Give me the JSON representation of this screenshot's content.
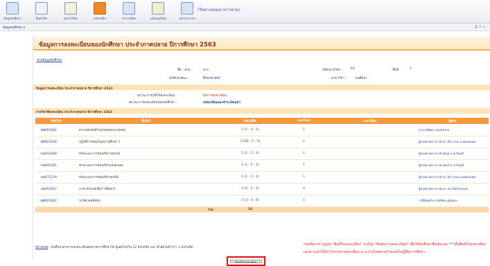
{
  "toolbar": {
    "items": [
      {
        "label": "ข้อมูลนักศึกษา"
      },
      {
        "label": "ยื่นคำร้อง"
      },
      {
        "label": "ผลการเรียน"
      },
      {
        "label": "ลงทะเบียน"
      },
      {
        "label": "ตารางเรียน"
      },
      {
        "label": "แจ้งแผนเรียน"
      },
      {
        "label": "ออกจากระบบ"
      }
    ],
    "title": "(วิทยาเขตมหาสารคาม)"
  },
  "subbar": {
    "left": "ข้อมูลนักศึกษา ▾",
    "right": "⎙ ↕ ▭"
  },
  "page": {
    "title": "ข้อมูลการลงทะเบียนของนักศึกษา ประจำภาคปลาย ปีการศึกษา 2563"
  },
  "student": {
    "link": "ส่วนข้อมูลนักศึกษา",
    "name_label": "ชื่อ - สกุล :",
    "name_value": "นาง",
    "status_label": "สถานะ :",
    "status_value": "นักศึกษาปกติ",
    "id_label": "รหัสประจำตัว :",
    "id_value": "63",
    "level_label": "ชั้นปี :",
    "level_value": "1",
    "program_label": "นักศึกษาคณะ :",
    "program_value": "ศึกษาศาสตร์",
    "major_label": "สาขาวิชา :",
    "major_value": "พลศึกษา"
  },
  "registration": {
    "header": "ข้อมูลการลงทะเบียน ประจำภาคปลาย ปีการศึกษา 2563",
    "status_label": "สถานะการเปิดให้ลงทะเบียน :",
    "status_value": "ปิดการลงทะเบียน",
    "reg_label": "สถานะการลงทะเบียนของนักศึกษา :",
    "reg_value": "ลงทะเบียนและชำระเงินแล้ว"
  },
  "courses": {
    "header": "รายวิชาที่ลงทะเบียน ประจำภาคปลาย ปีการศึกษา 2563",
    "columns": [
      "รหัสวิชา",
      "ชื่อวิชา",
      "หน่วยกิต",
      "section",
      "เวลาเรียน",
      "ผู้สอน"
    ],
    "rows": [
      {
        "code": "ศศ001004",
        "name": "ความสัมพันธ์กับปกครองและชุมชน",
        "credit": "2 (1 - 2 - 3)",
        "section": "1",
        "time": "",
        "teacher": "อาจารย์นิตยา ทองกันสาย"
      },
      {
        "code": "ศศ021034",
        "name": "ปฏิบัติการสอนในสถานศึกษา 1",
        "credit": "2 (90 - 0 - 0)",
        "section": "1",
        "time": "",
        "teacher": "ผู้ช่วยศาสตราจารย์ ดร. จีระวรรณ กมลพนธนพร"
      },
      {
        "code": "พล032448",
        "name": "ทักษะและการสอนกีฬาวอลเลย์",
        "credit": "2 (1 - 2 - 3)",
        "section": "1",
        "time": "",
        "teacher": "ผู้ช่วยศาสตราจารย์ สุพจน์ นาจาริยนต์"
      },
      {
        "code": "พล042181",
        "name": "ทักษะและการสอนกีฬาแฮนด์บอล",
        "credit": "2 (1 - 2 - 3)",
        "section": "1",
        "time": "",
        "teacher": "ผู้ช่วยศาสตราจารย์ สุพจน์ นาจาริยนต์"
      },
      {
        "code": "พล072139",
        "name": "ทักษะและการสอนกีฬาเทนนิส",
        "credit": "2 (1 - 2 - 3)",
        "section": "1",
        "time": "",
        "teacher": "ผู้ช่วยศาสตราจารย์ ดร. จีระวรรณ กมลพนธนพร"
      },
      {
        "code": "มส051057",
        "name": "ภาษาอังกฤษเพื่อการสื่อสาร",
        "credit": "3 (2 - 2 - 5)",
        "section": "4",
        "time": "",
        "teacher": "ผู้ช่วยศาสตราจารย์ ดร. ประวิทย์ ทรงกนธ"
      },
      {
        "code": "ศศ021002",
        "name": "นวนิยายคดีสมัย",
        "credit": "3 (3 - 0 - 6)",
        "section": "1",
        "time": "",
        "teacher": "ว่าที่ร้อยตรี ดร.กิตติชัย แย้มอ่อน"
      }
    ],
    "total_label": "รวม",
    "total_value": "16"
  },
  "note": {
    "link": "หมายเหตุ",
    "text": ": นักศึกษาสามารถลงทะเบียนต่อภาคการศึกษาได้ สูงสุดไม่เกิน 22 หน่วยกิต และ ต่ำสุดไม่ต่ำกว่า 2 หน่วยกิต"
  },
  "warning": {
    "text": "ก่อนที่จะปรากฏปุ่ม \"พิมพ์ใบลงทะเบียน\" จะมีปุ่ม \"ยืนยันการลงทะเบียน\" เพื่อให้นักศึกษายืนยันก่อน ***เมื่อพิมพ์ใบลงทะเบียนเอกสารแล้วให้นำไปจ่ายค่าลงทะเบียน ณ ธ.กรุงไทยตามกำหนดในปฏิทินการศึกษา"
  },
  "print_button": {
    "label": "พิมพ์ใบลงทะเบียน"
  },
  "colors": {
    "accent": "#f39a40",
    "warning": "#e0231b",
    "link": "#1a3d8f",
    "title": "#8b2d1a"
  }
}
